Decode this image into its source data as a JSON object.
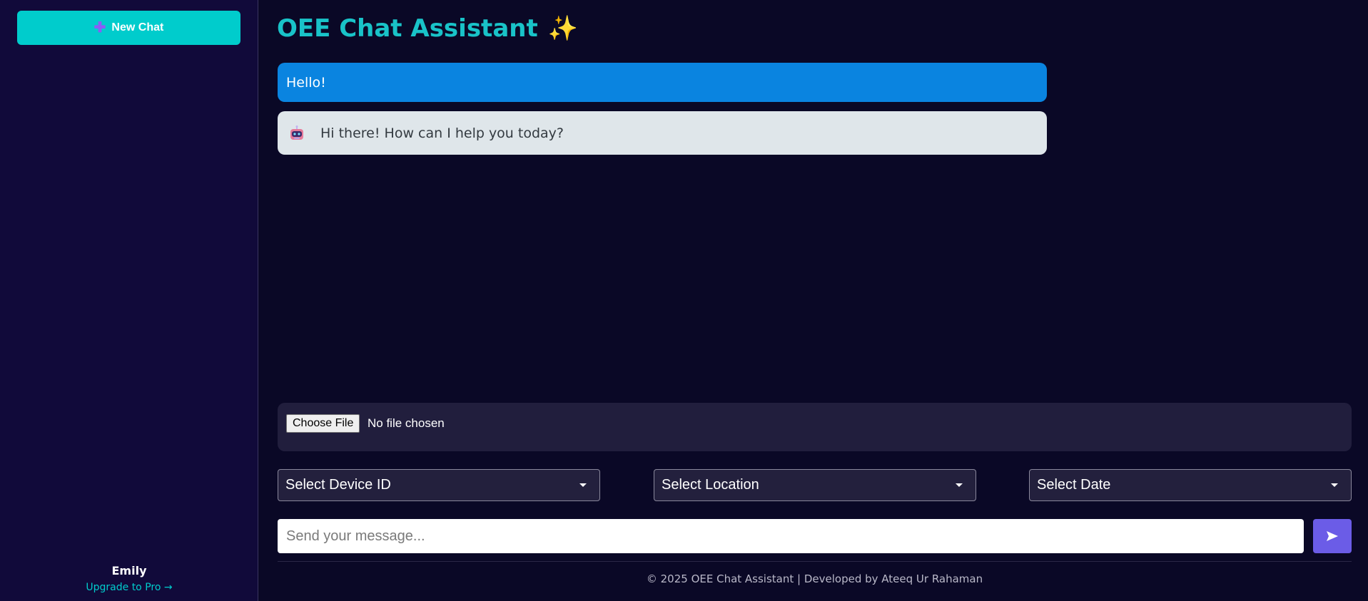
{
  "sidebar": {
    "new_chat_label": "New Chat",
    "new_chat_icon": "plus-icon",
    "user_name": "Emily",
    "upgrade_label": "Upgrade to Pro →"
  },
  "header": {
    "title": "OEE Chat Assistant",
    "title_emoji": "✨"
  },
  "messages": [
    {
      "role": "user",
      "text": "Hello!"
    },
    {
      "role": "assistant",
      "avatar": "robot-icon",
      "text": "Hi there! How can I help you today?"
    }
  ],
  "file_upload": {
    "button_label": "Choose File",
    "status": "No file chosen"
  },
  "filters": {
    "device": "Select Device ID",
    "location": "Select Location",
    "date": "Select Date"
  },
  "composer": {
    "placeholder": "Send your message...",
    "send_icon": "send-icon"
  },
  "footer": {
    "text": "© 2025 OEE Chat Assistant | Developed by Ateeq Ur Rahaman"
  },
  "colors": {
    "background": "#0a0826",
    "sidebar": "#110a3a",
    "accent": "#00cccc",
    "user_bubble": "#0a84e0",
    "bot_bubble": "#dfe6ea",
    "send_button": "#6b5ce7"
  }
}
